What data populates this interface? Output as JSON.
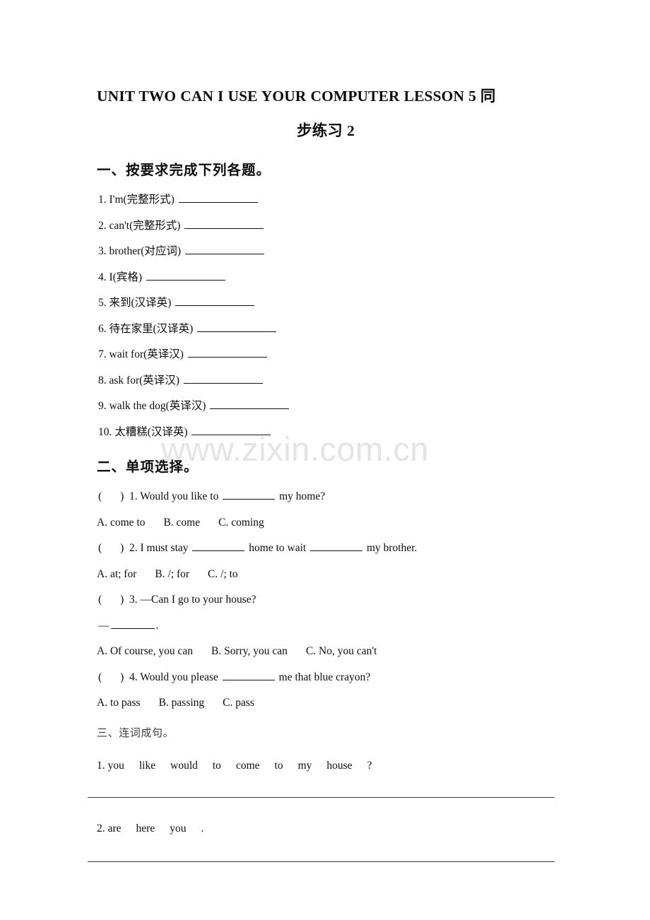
{
  "document": {
    "title_line1": "UNIT TWO CAN I USE YOUR COMPUTER LESSON 5  同",
    "title_line2": "步练习 2",
    "watermark": "www.zixin.com.cn"
  },
  "section_one": {
    "heading": "一、按要求完成下列各题。",
    "items": [
      {
        "num": "1.",
        "prompt": "I'm(完整形式)"
      },
      {
        "num": "2.",
        "prompt": "can't(完整形式)"
      },
      {
        "num": "3.",
        "prompt": "brother(对应词)"
      },
      {
        "num": "4.",
        "prompt": "I(宾格)"
      },
      {
        "num": "5.",
        "prompt": "来到(汉译英)"
      },
      {
        "num": "6.",
        "prompt": "待在家里(汉译英)"
      },
      {
        "num": "7.",
        "prompt": "wait for(英译汉)"
      },
      {
        "num": "8.",
        "prompt": "ask for(英译汉)"
      },
      {
        "num": "9.",
        "prompt": "walk the dog(英译汉)"
      },
      {
        "num": "10.",
        "prompt": "太糟糕(汉译英)"
      }
    ]
  },
  "section_two": {
    "heading": "二、单项选择。",
    "questions": [
      {
        "num": "1.",
        "stem_before": "Would you like to",
        "stem_after": "my home?",
        "options": [
          "A. come to",
          "B. come",
          "C. coming"
        ]
      },
      {
        "num": "2.",
        "stem_before": "I must stay",
        "stem_mid": "home to wait",
        "stem_after": "my brother.",
        "options": [
          "A. at; for",
          "B. /; for",
          "C. /; to"
        ]
      },
      {
        "num": "3.",
        "stem_before": "—Can I go to your house?",
        "answer_line_prefix": "—",
        "answer_line_suffix": ".",
        "options": [
          "A. Of course, you can",
          "B. Sorry, you can",
          "C. No, you can't"
        ]
      },
      {
        "num": "4.",
        "stem_before": "Would you please",
        "stem_after": "me that blue crayon?",
        "options": [
          "A. to pass",
          "B. passing",
          "C. pass"
        ]
      }
    ]
  },
  "section_three": {
    "heading": "三、连词成句。",
    "items": [
      {
        "num": "1.",
        "words": [
          "you",
          "like",
          "would",
          "to",
          "come",
          "to",
          "my",
          "house",
          "?"
        ]
      },
      {
        "num": "2.",
        "words": [
          "are",
          "here",
          "you",
          "."
        ]
      }
    ]
  }
}
